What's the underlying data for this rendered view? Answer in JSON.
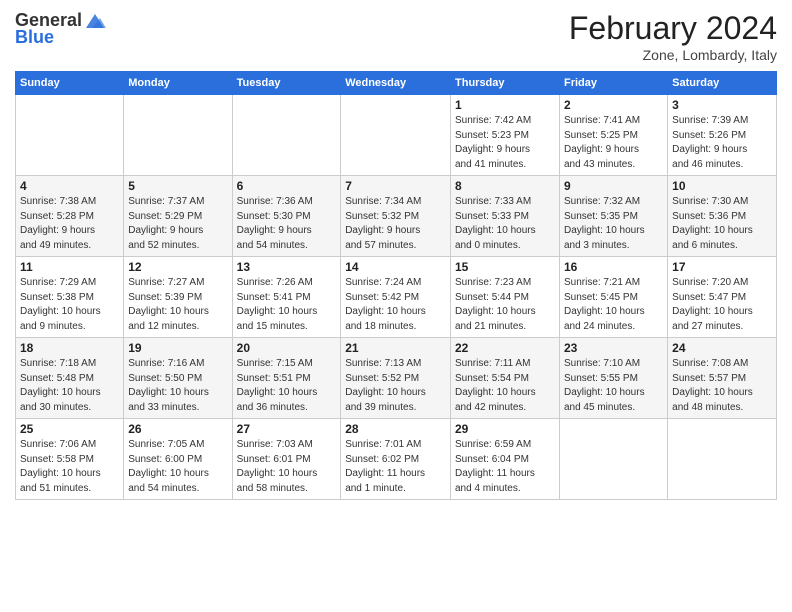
{
  "logo": {
    "general": "General",
    "blue": "Blue"
  },
  "header": {
    "title": "February 2024",
    "subtitle": "Zone, Lombardy, Italy"
  },
  "weekdays": [
    "Sunday",
    "Monday",
    "Tuesday",
    "Wednesday",
    "Thursday",
    "Friday",
    "Saturday"
  ],
  "weeks": [
    [
      {
        "day": "",
        "info": ""
      },
      {
        "day": "",
        "info": ""
      },
      {
        "day": "",
        "info": ""
      },
      {
        "day": "",
        "info": ""
      },
      {
        "day": "1",
        "info": "Sunrise: 7:42 AM\nSunset: 5:23 PM\nDaylight: 9 hours\nand 41 minutes."
      },
      {
        "day": "2",
        "info": "Sunrise: 7:41 AM\nSunset: 5:25 PM\nDaylight: 9 hours\nand 43 minutes."
      },
      {
        "day": "3",
        "info": "Sunrise: 7:39 AM\nSunset: 5:26 PM\nDaylight: 9 hours\nand 46 minutes."
      }
    ],
    [
      {
        "day": "4",
        "info": "Sunrise: 7:38 AM\nSunset: 5:28 PM\nDaylight: 9 hours\nand 49 minutes."
      },
      {
        "day": "5",
        "info": "Sunrise: 7:37 AM\nSunset: 5:29 PM\nDaylight: 9 hours\nand 52 minutes."
      },
      {
        "day": "6",
        "info": "Sunrise: 7:36 AM\nSunset: 5:30 PM\nDaylight: 9 hours\nand 54 minutes."
      },
      {
        "day": "7",
        "info": "Sunrise: 7:34 AM\nSunset: 5:32 PM\nDaylight: 9 hours\nand 57 minutes."
      },
      {
        "day": "8",
        "info": "Sunrise: 7:33 AM\nSunset: 5:33 PM\nDaylight: 10 hours\nand 0 minutes."
      },
      {
        "day": "9",
        "info": "Sunrise: 7:32 AM\nSunset: 5:35 PM\nDaylight: 10 hours\nand 3 minutes."
      },
      {
        "day": "10",
        "info": "Sunrise: 7:30 AM\nSunset: 5:36 PM\nDaylight: 10 hours\nand 6 minutes."
      }
    ],
    [
      {
        "day": "11",
        "info": "Sunrise: 7:29 AM\nSunset: 5:38 PM\nDaylight: 10 hours\nand 9 minutes."
      },
      {
        "day": "12",
        "info": "Sunrise: 7:27 AM\nSunset: 5:39 PM\nDaylight: 10 hours\nand 12 minutes."
      },
      {
        "day": "13",
        "info": "Sunrise: 7:26 AM\nSunset: 5:41 PM\nDaylight: 10 hours\nand 15 minutes."
      },
      {
        "day": "14",
        "info": "Sunrise: 7:24 AM\nSunset: 5:42 PM\nDaylight: 10 hours\nand 18 minutes."
      },
      {
        "day": "15",
        "info": "Sunrise: 7:23 AM\nSunset: 5:44 PM\nDaylight: 10 hours\nand 21 minutes."
      },
      {
        "day": "16",
        "info": "Sunrise: 7:21 AM\nSunset: 5:45 PM\nDaylight: 10 hours\nand 24 minutes."
      },
      {
        "day": "17",
        "info": "Sunrise: 7:20 AM\nSunset: 5:47 PM\nDaylight: 10 hours\nand 27 minutes."
      }
    ],
    [
      {
        "day": "18",
        "info": "Sunrise: 7:18 AM\nSunset: 5:48 PM\nDaylight: 10 hours\nand 30 minutes."
      },
      {
        "day": "19",
        "info": "Sunrise: 7:16 AM\nSunset: 5:50 PM\nDaylight: 10 hours\nand 33 minutes."
      },
      {
        "day": "20",
        "info": "Sunrise: 7:15 AM\nSunset: 5:51 PM\nDaylight: 10 hours\nand 36 minutes."
      },
      {
        "day": "21",
        "info": "Sunrise: 7:13 AM\nSunset: 5:52 PM\nDaylight: 10 hours\nand 39 minutes."
      },
      {
        "day": "22",
        "info": "Sunrise: 7:11 AM\nSunset: 5:54 PM\nDaylight: 10 hours\nand 42 minutes."
      },
      {
        "day": "23",
        "info": "Sunrise: 7:10 AM\nSunset: 5:55 PM\nDaylight: 10 hours\nand 45 minutes."
      },
      {
        "day": "24",
        "info": "Sunrise: 7:08 AM\nSunset: 5:57 PM\nDaylight: 10 hours\nand 48 minutes."
      }
    ],
    [
      {
        "day": "25",
        "info": "Sunrise: 7:06 AM\nSunset: 5:58 PM\nDaylight: 10 hours\nand 51 minutes."
      },
      {
        "day": "26",
        "info": "Sunrise: 7:05 AM\nSunset: 6:00 PM\nDaylight: 10 hours\nand 54 minutes."
      },
      {
        "day": "27",
        "info": "Sunrise: 7:03 AM\nSunset: 6:01 PM\nDaylight: 10 hours\nand 58 minutes."
      },
      {
        "day": "28",
        "info": "Sunrise: 7:01 AM\nSunset: 6:02 PM\nDaylight: 11 hours\nand 1 minute."
      },
      {
        "day": "29",
        "info": "Sunrise: 6:59 AM\nSunset: 6:04 PM\nDaylight: 11 hours\nand 4 minutes."
      },
      {
        "day": "",
        "info": ""
      },
      {
        "day": "",
        "info": ""
      }
    ]
  ]
}
